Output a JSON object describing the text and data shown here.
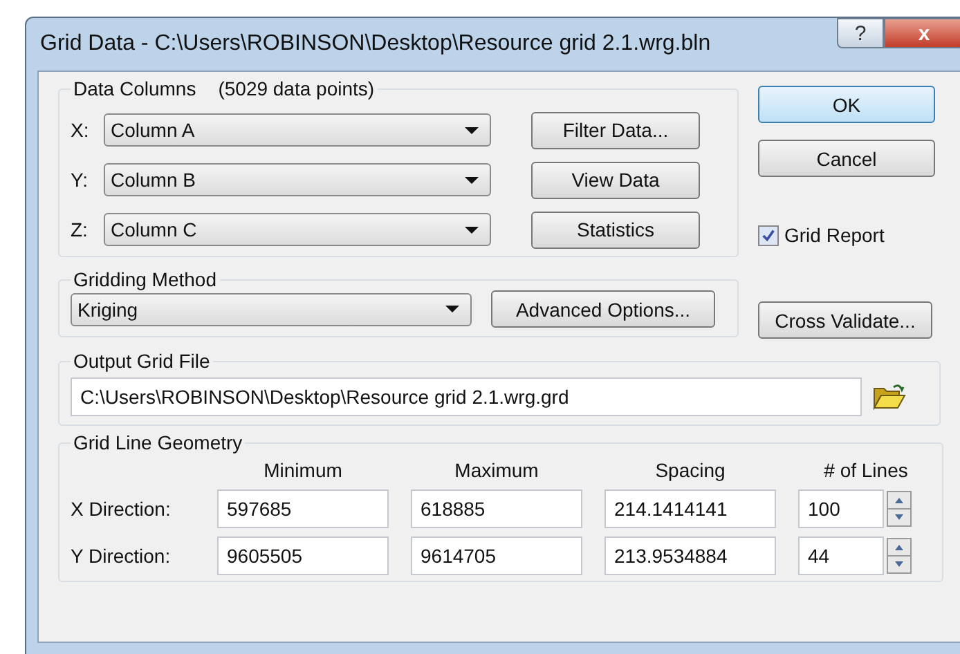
{
  "window": {
    "title": "Grid Data - C:\\Users\\ROBINSON\\Desktop\\Resource grid 2.1.wrg.bln",
    "help_button": "?",
    "close_button": "x"
  },
  "data_columns": {
    "title": "Data Columns",
    "count": "(5029 data points)",
    "rows": [
      {
        "label": "X:",
        "value": "Column A",
        "button": "Filter Data..."
      },
      {
        "label": "Y:",
        "value": "Column B",
        "button": "View Data"
      },
      {
        "label": "Z:",
        "value": "Column C",
        "button": "Statistics"
      }
    ]
  },
  "buttons": [
    {
      "label": "OK",
      "default": true
    },
    {
      "label": "Cancel",
      "default": false
    }
  ],
  "grid_report": {
    "label": "Grid Report",
    "checked": true
  },
  "gridding_method": {
    "title": "Gridding Method",
    "value": "Kriging",
    "button": "Advanced Options..."
  },
  "cross_validate": "Cross Validate...",
  "output_grid_file": {
    "title": "Output Grid File",
    "value": "C:\\Users\\ROBINSON\\Desktop\\Resource grid 2.1.wrg.grd"
  },
  "geometry": {
    "title": "Grid Line Geometry",
    "columns": [
      "Minimum",
      "Maximum",
      "Spacing",
      "# of Lines"
    ],
    "rows": [
      {
        "label": "X Direction:",
        "minimum": "597685",
        "maximum": "618885",
        "spacing": "214.1414141",
        "lines": "100"
      },
      {
        "label": "Y Direction:",
        "minimum": "9605505",
        "maximum": "9614705",
        "spacing": "213.9534884",
        "lines": "44"
      }
    ]
  }
}
